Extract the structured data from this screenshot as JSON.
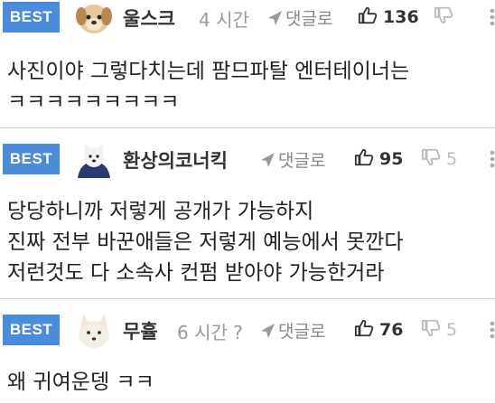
{
  "comments": [
    {
      "badge": "BEST",
      "nickname": "울스크",
      "time": "4 시간",
      "reply_label": "댓글로",
      "upvotes": "136",
      "downvotes": "",
      "lines": [
        "사진이야 그렇다치는데 팜므파탈 엔터테이너는",
        "ㅋㅋㅋㅋㅋㅋㅋㅋㅋ"
      ]
    },
    {
      "badge": "BEST",
      "nickname": "환상의코너킥",
      "time": "",
      "reply_label": "댓글로",
      "upvotes": "95",
      "downvotes": "5",
      "lines": [
        "당당하니까 저렇게 공개가 가능하지",
        "진짜 전부 바꾼애들은 저렇게 예능에서 못깐다",
        "저런것도 다 소속사 컨펌 받아야 가능한거라"
      ]
    },
    {
      "badge": "BEST",
      "nickname": "무휼",
      "time": "6 시간 ?",
      "reply_label": "댓글로",
      "upvotes": "76",
      "downvotes": "5",
      "lines": [
        "왜 귀여운뎅 ㅋㅋ"
      ]
    }
  ]
}
